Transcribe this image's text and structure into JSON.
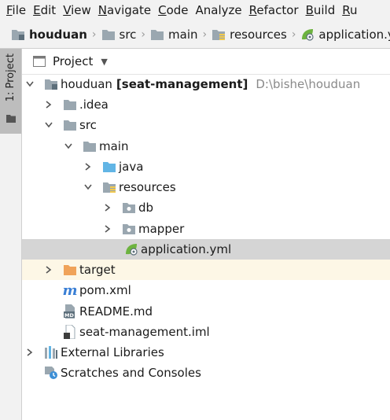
{
  "menu": [
    {
      "u": "F",
      "rest": "ile"
    },
    {
      "u": "E",
      "rest": "dit"
    },
    {
      "u": "V",
      "rest": "iew"
    },
    {
      "u": "N",
      "rest": "avigate"
    },
    {
      "u": "C",
      "rest": "ode"
    },
    {
      "u": "",
      "rest": "Analyze"
    },
    {
      "u": "R",
      "rest": "efactor"
    },
    {
      "u": "B",
      "rest": "uild"
    },
    {
      "u": "R",
      "rest": "u"
    }
  ],
  "breadcrumb": [
    "houduan",
    "src",
    "main",
    "resources",
    "application.yml"
  ],
  "side_tab": {
    "label": "1: Project"
  },
  "panel": {
    "title": "Project"
  },
  "tree": {
    "root": {
      "name": "houduan",
      "module": "[seat-management]",
      "path": "D:\\bishe\\houduan"
    },
    "idea": ".idea",
    "src": "src",
    "main": "main",
    "java": "java",
    "resources": "resources",
    "db": "db",
    "mapper": "mapper",
    "application": "application.yml",
    "target": "target",
    "pom": "pom.xml",
    "readme": "README.md",
    "iml": "seat-management.iml",
    "ext_libs": "External Libraries",
    "scratches": "Scratches and Consoles"
  },
  "colors": {
    "folder_gray": "#9aa7b0",
    "folder_blue": "#62b5e5",
    "folder_orange": "#f0a35a",
    "resources_bar": "#f2c94c",
    "spring_green": "#6db33f",
    "selected_row": "#d5d5d5"
  }
}
